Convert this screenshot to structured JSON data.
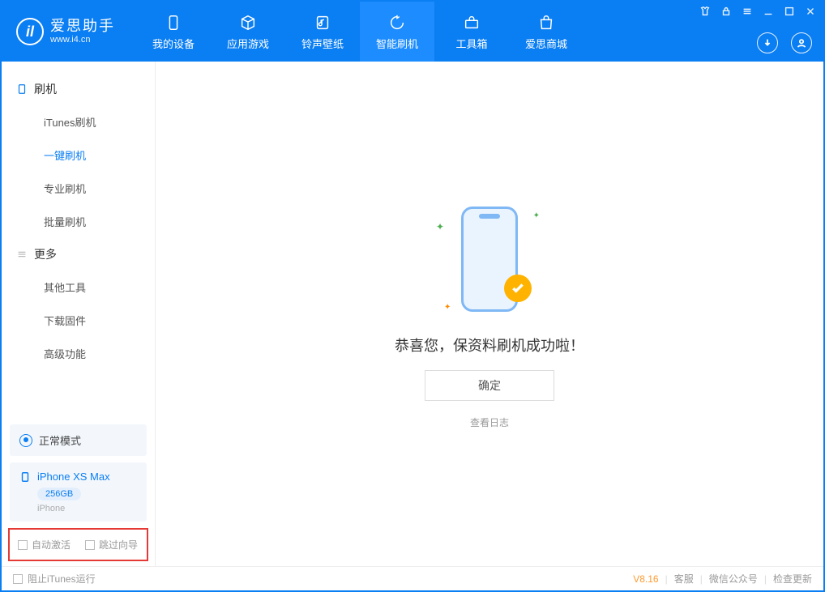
{
  "app": {
    "name_cn": "爱思助手",
    "name_en": "www.i4.cn"
  },
  "nav": {
    "tabs": [
      {
        "id": "device",
        "label": "我的设备"
      },
      {
        "id": "apps",
        "label": "应用游戏"
      },
      {
        "id": "ringtone",
        "label": "铃声壁纸"
      },
      {
        "id": "flash",
        "label": "智能刷机"
      },
      {
        "id": "toolbox",
        "label": "工具箱"
      },
      {
        "id": "store",
        "label": "爱思商城"
      }
    ],
    "active": "flash"
  },
  "sidebar": {
    "sections": [
      {
        "title": "刷机",
        "items": [
          "iTunes刷机",
          "一键刷机",
          "专业刷机",
          "批量刷机"
        ],
        "active_index": 1
      },
      {
        "title": "更多",
        "items": [
          "其他工具",
          "下载固件",
          "高级功能"
        ],
        "active_index": -1
      }
    ],
    "mode": "正常模式",
    "device": {
      "name": "iPhone XS Max",
      "storage": "256GB",
      "type": "iPhone"
    },
    "checks": {
      "auto_activate": "自动激活",
      "skip_guide": "跳过向导"
    }
  },
  "main": {
    "success": "恭喜您，保资料刷机成功啦！",
    "ok": "确定",
    "view_log": "查看日志"
  },
  "statusbar": {
    "block_itunes": "阻止iTunes运行",
    "version": "V8.16",
    "links": [
      "客服",
      "微信公众号",
      "检查更新"
    ]
  }
}
